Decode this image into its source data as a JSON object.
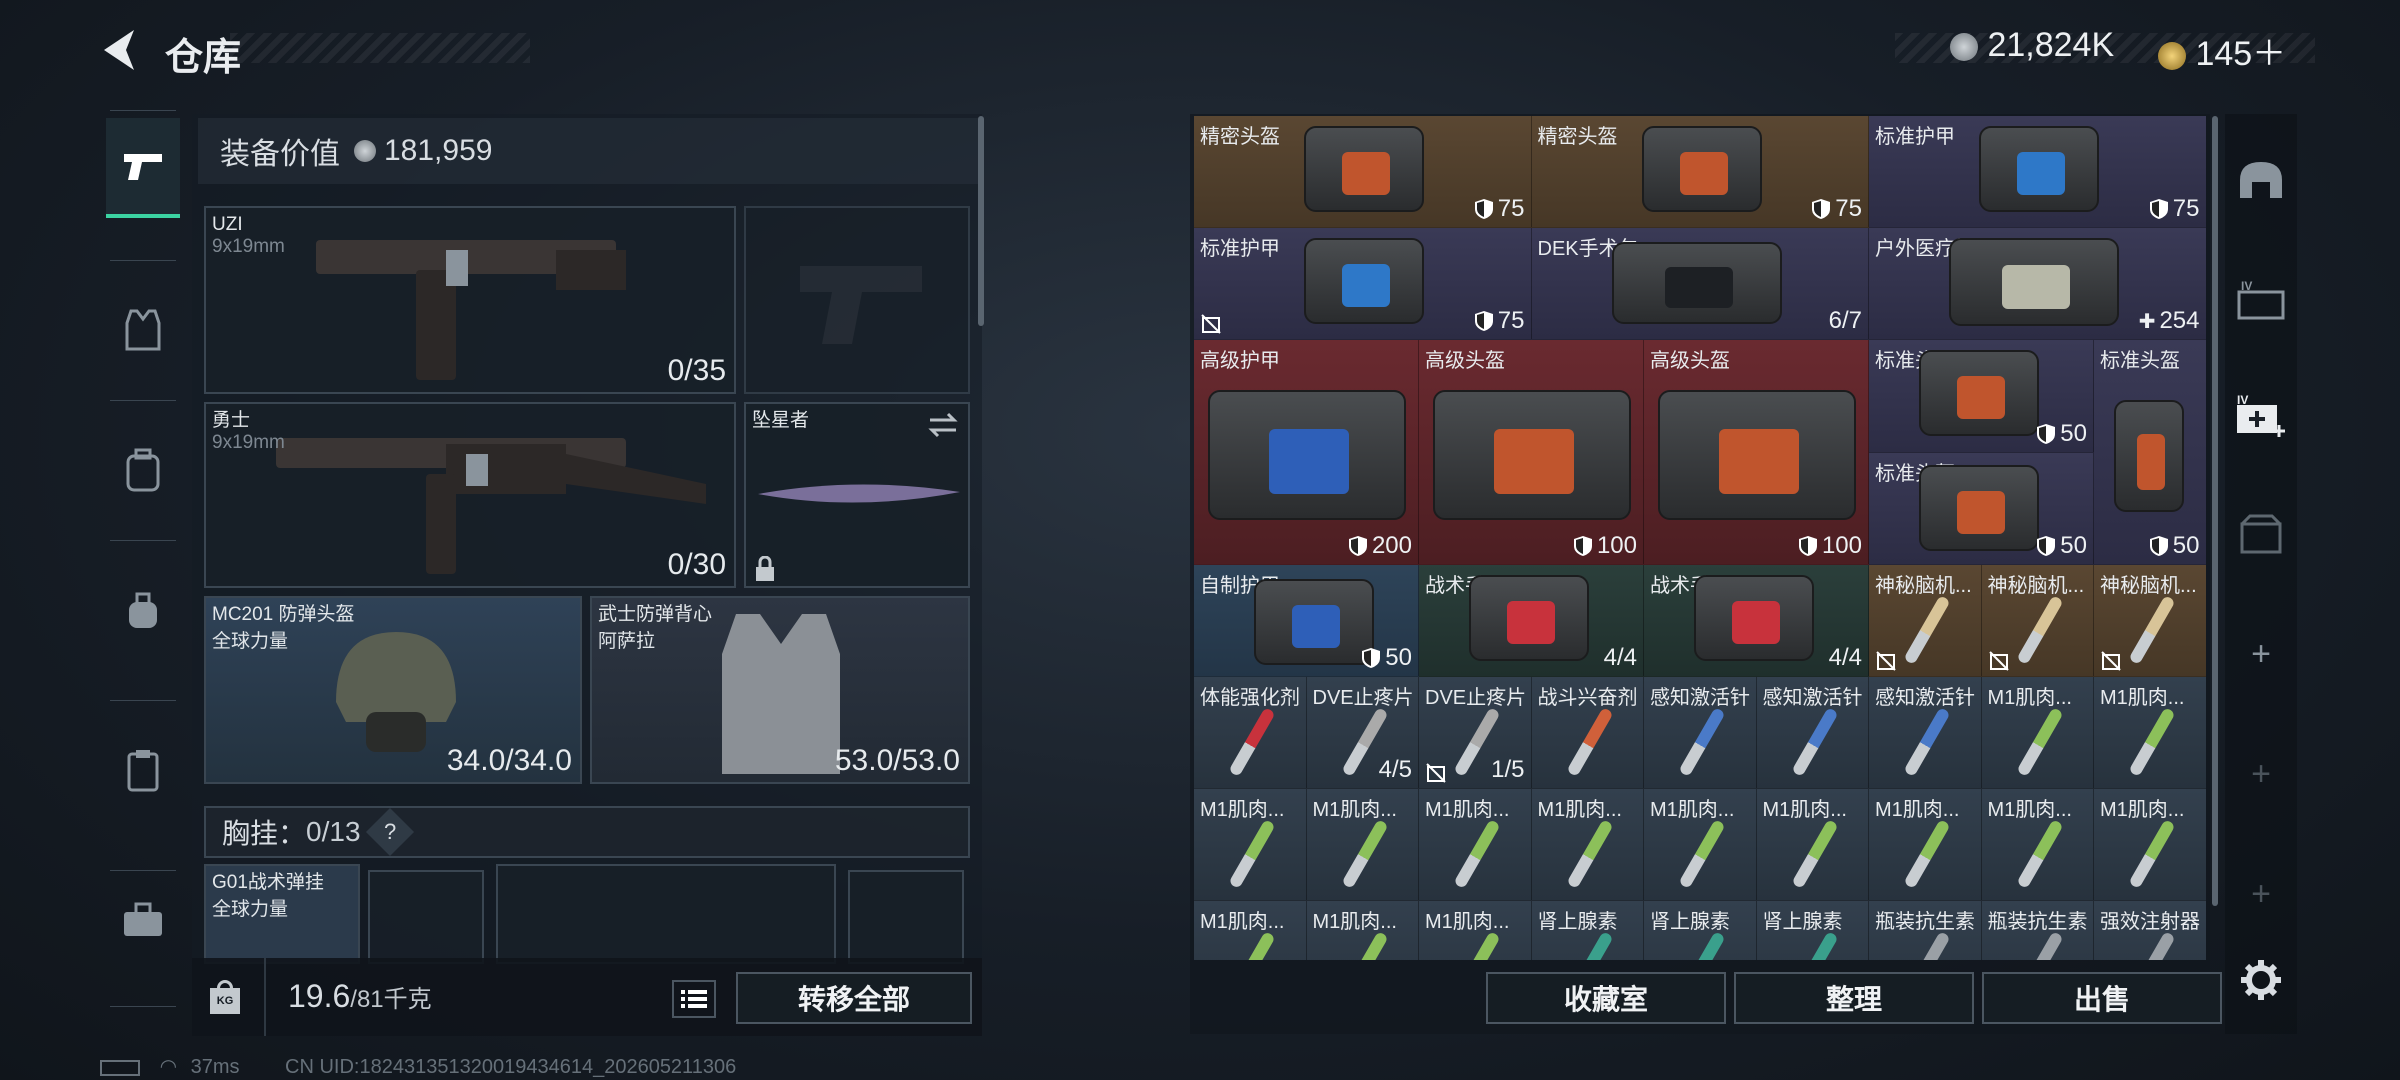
{
  "header": {
    "title": "仓库",
    "currency_a": "21,824K",
    "currency_b": "145＋"
  },
  "colors": {
    "accent": "#3bd3a2",
    "brown": "#5a4732",
    "red": "#6a2a30",
    "purple": "#3a3a56"
  },
  "left_sidebar": {
    "items": [
      {
        "icon": "pistol-icon"
      },
      {
        "icon": "vest-icon"
      },
      {
        "icon": "backpack-icon"
      },
      {
        "icon": "bag-icon"
      },
      {
        "icon": "clipboard-icon"
      },
      {
        "icon": "toolbox-icon"
      }
    ]
  },
  "equipment": {
    "value_label": "装备价值",
    "value": "181,959",
    "primary": {
      "name": "UZI",
      "caliber": "9x19mm",
      "ammo": "0/35"
    },
    "secondary": {
      "name": "勇士",
      "caliber": "9x19mm",
      "ammo": "0/30"
    },
    "melee": {
      "name": "坠星者"
    },
    "helmet": {
      "name": "MC201 防弹头盔",
      "sub": "全球力量",
      "durability": "34.0/34.0"
    },
    "armor": {
      "name": "武士防弹背心",
      "sub": "阿萨拉",
      "durability": "53.0/53.0"
    },
    "chest": {
      "label": "胸挂",
      "capacity": "0/13",
      "help": "?"
    },
    "rig": {
      "name": "G01战术弹挂",
      "sub": "全球力量"
    },
    "weight": {
      "value": "19.6",
      "max": "/81千克",
      "icon": "KG"
    },
    "transfer_all": "转移全部"
  },
  "inventory": {
    "row1": [
      {
        "label": "精密头盔",
        "value": "75"
      },
      {
        "label": "精密头盔",
        "value": "75"
      },
      {
        "label": "标准护甲",
        "value": "75"
      }
    ],
    "row2": [
      {
        "label": "标准护甲",
        "value": "75"
      },
      {
        "label": "DEK手术包",
        "value": "6/7"
      },
      {
        "label": "户外医疗箱",
        "value": "254"
      }
    ],
    "row3": [
      {
        "label": "高级护甲",
        "value": "200"
      },
      {
        "label": "高级头盔",
        "value": "100"
      },
      {
        "label": "高级头盔",
        "value": "100"
      },
      {
        "label": "标准头盔",
        "value": "50"
      },
      {
        "label": "标准头盔",
        "value": "50"
      },
      {
        "label": "标准头盔",
        "value": "50"
      }
    ],
    "row4": [
      {
        "label": "自制护甲",
        "value": "50"
      },
      {
        "label": "战术手术包",
        "value": "4/4"
      },
      {
        "label": "战术手术包",
        "value": "4/4"
      },
      {
        "label": "神秘脑机..."
      },
      {
        "label": "神秘脑机..."
      },
      {
        "label": "神秘脑机..."
      }
    ],
    "row5": [
      {
        "label": "体能强化剂"
      },
      {
        "label": "DVE止疼片",
        "value": "4/5"
      },
      {
        "label": "DVE止疼片",
        "value": "1/5"
      },
      {
        "label": "战斗兴奋剂"
      },
      {
        "label": "感知激活针"
      },
      {
        "label": "感知激活针"
      },
      {
        "label": "感知激活针"
      },
      {
        "label": "M1肌肉..."
      },
      {
        "label": "M1肌肉..."
      }
    ],
    "row6": [
      "M1肌肉...",
      "M1肌肉...",
      "M1肌肉...",
      "M1肌肉...",
      "M1肌肉...",
      "M1肌肉...",
      "M1肌肉...",
      "M1肌肉...",
      "M1肌肉..."
    ],
    "row7": [
      "M1肌肉...",
      "M1肌肉...",
      "M1肌肉...",
      "肾上腺素",
      "肾上腺素",
      "肾上腺素",
      "瓶装抗生素",
      "瓶装抗生素",
      "强效注射器"
    ]
  },
  "actions": {
    "collection": "收藏室",
    "sort": "整理",
    "sell": "出售"
  },
  "right_sidebar": {
    "items": [
      {
        "icon": "helmet-slot-icon"
      },
      {
        "icon": "ammo-box-icon"
      },
      {
        "icon": "medkit-add-icon"
      },
      {
        "icon": "stash-icon"
      },
      {
        "icon": "plus-icon"
      },
      {
        "icon": "plus-icon"
      },
      {
        "icon": "plus-icon"
      },
      {
        "icon": "gear-icon"
      }
    ]
  },
  "status": {
    "ping": "37ms",
    "uid": "CN UID:18243135132001943461​4_202605211306"
  }
}
